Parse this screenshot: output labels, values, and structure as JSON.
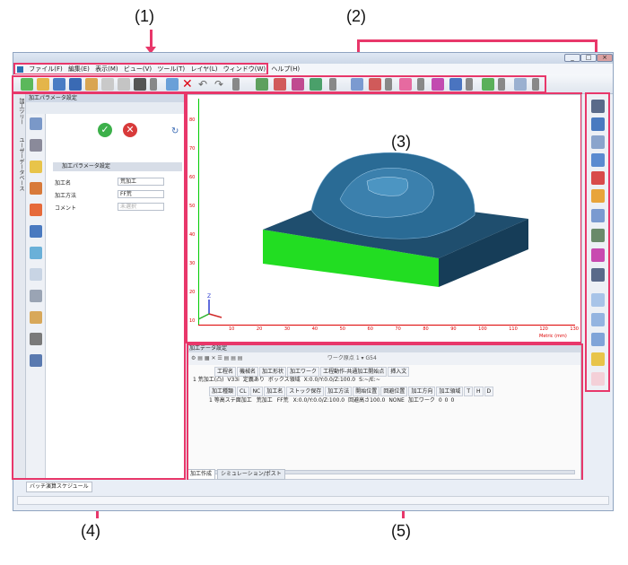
{
  "callouts": {
    "c1": "(1)",
    "c2": "(2)",
    "c3": "(3)",
    "c4": "(4)",
    "c5": "(5)"
  },
  "menu": [
    "ファイル(F)",
    "編集(E)",
    "表示(M)",
    "ビュー(V)",
    "ツール(T)",
    "レイヤ(L)",
    "ウィンドウ(W)",
    "ヘルプ(H)"
  ],
  "left_panel": {
    "title": "加工パラメータ設定",
    "vertical_tabs": [
      "加工ツリー",
      "ユーザーデータベース"
    ],
    "section_title": "加工パラメータ設定",
    "fields": [
      {
        "label": "加工名",
        "value": "荒加工"
      },
      {
        "label": "加工方法",
        "value": "FF荒"
      },
      {
        "label": "コメント",
        "value": "未選択"
      }
    ]
  },
  "viewport": {
    "y_ticks": [
      "80",
      "70",
      "60",
      "50",
      "40",
      "30",
      "20",
      "10"
    ],
    "x_ticks": [
      "10",
      "20",
      "30",
      "40",
      "50",
      "60",
      "70",
      "80",
      "90",
      "100",
      "110",
      "120",
      "130"
    ],
    "units": "Metric (mm)"
  },
  "data_panel": {
    "title": "加工データ設定",
    "toolbar_text": "ワーク原点 1 ▾  G54",
    "top_headers": [
      "工程名",
      "機械名",
      "加工形状",
      "加工ワーク",
      "工程動作-共通加工開始点",
      "挿入文"
    ],
    "top_row": [
      "1 荒加工(凸)",
      "V33i",
      "定義あり",
      "ボックス領域",
      "X:0.0/Y:0.0/Z:100.0",
      "S:~/E:~"
    ],
    "headers": [
      "加工種類",
      "CL",
      "NC",
      "加工名",
      "ストック保存",
      "加工方法",
      "開始位置",
      "回避位置",
      "加工方向",
      "加工領域",
      "T",
      "H",
      "D"
    ],
    "row": [
      "1 等高ステ面加工",
      "",
      "",
      "荒加工",
      "",
      "FF荒",
      "X:0.0/Y:0.0/Z:100.0",
      "回避高さ100.0",
      "NONE",
      "加工ワーク",
      "0",
      "0",
      "0"
    ]
  },
  "bottom_tabs": [
    "加工作成",
    "シミュレーション/ポスト"
  ],
  "status_tab": "バッチ演算スケジュール",
  "colors": {
    "accent": "#e8376a",
    "model": "#1f4e6e",
    "base": "#1ee81e",
    "axis_y": "#0c0",
    "axis_x": "#d00"
  }
}
